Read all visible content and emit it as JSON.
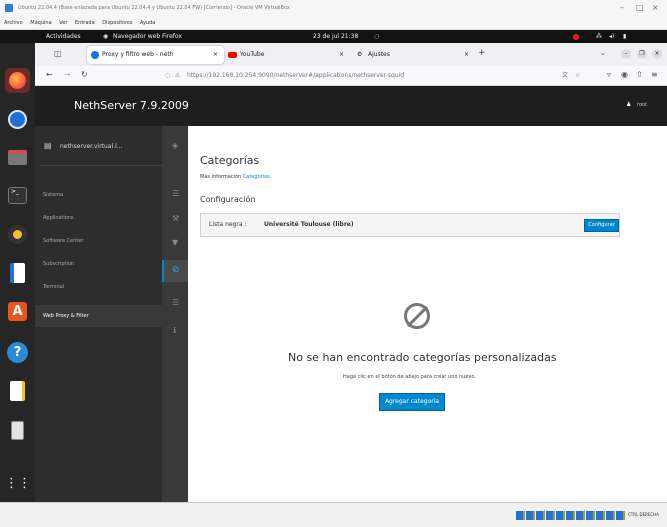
{
  "vbox": {
    "title": "Ubuntu 22.04.4 (Base enlazada para Ubuntu 22.04.4 y Ubuntu 22.04 FW) [Corriendo] - Oracle VM VirtualBox",
    "menu": [
      "Archivo",
      "Máquina",
      "Ver",
      "Entrada",
      "Dispositivos",
      "Ayuda"
    ],
    "status_hint": "CTRL DERECHA"
  },
  "ubuntu": {
    "activities": "Actividades",
    "app_name": "Navegador web Firefox",
    "clock": "23 de jul 21:38"
  },
  "firefox": {
    "tabs": [
      {
        "label": "Proxy y filtro web - neth"
      },
      {
        "label": "YouTube"
      },
      {
        "label": "Ajustes"
      }
    ],
    "url": "https://192.168.10.254:9090/nethserver#/applications/nethserver-squid"
  },
  "nethserver": {
    "brand": "NethServer 7.9.2009",
    "user": "root",
    "host": "nethserver.virtual.l...",
    "nav": [
      "Sistema",
      "Applications",
      "Software Center",
      "Subscription",
      "Terminal",
      "Web Proxy & Filter"
    ],
    "page_title": "Categorías",
    "more_info_prefix": "Más información",
    "more_info_link": "Categorías.",
    "section_title": "Configuración",
    "blacklist_label": "Lista negra :",
    "blacklist_value": "Université Toulouse (libre)",
    "configure_button": "Configurar",
    "empty_title": "No se han encontrado categorías personalizadas",
    "empty_hint": "Haga clic en el botón de abajo para crear uno nuevo.",
    "add_button": "Agregar categoría"
  }
}
